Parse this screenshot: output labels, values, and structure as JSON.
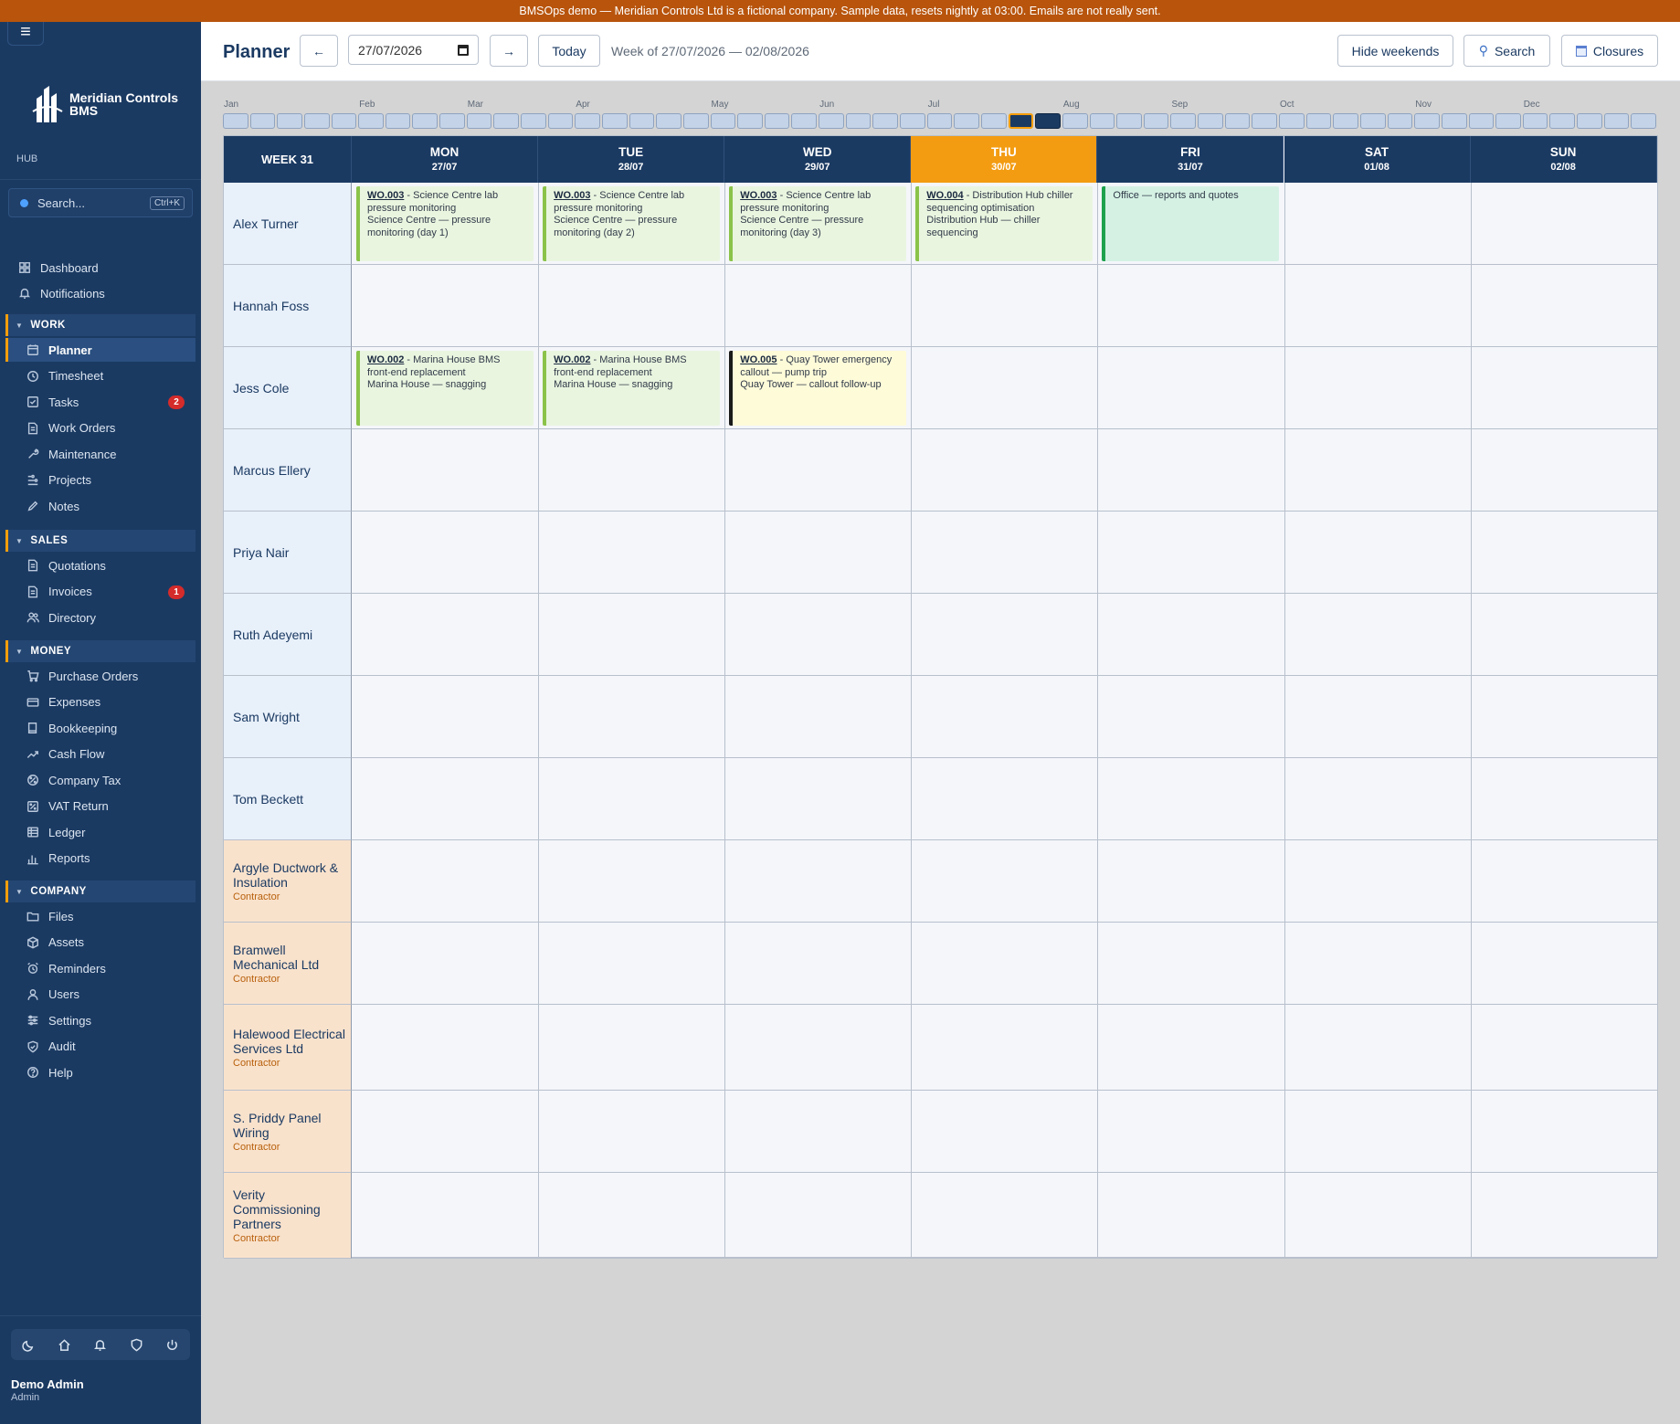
{
  "banner": "BMSOps demo — Meridian Controls Ltd is a fictional company. Sample data, resets nightly at 03:00. Emails are not really sent.",
  "sidebar": {
    "brand_name": "Meridian Controls",
    "brand_sub": "BMS",
    "hub": "HUB",
    "search_placeholder": "Search...",
    "search_shortcut": "Ctrl+K",
    "top_items": [
      {
        "label": "Dashboard",
        "icon": "grid-icon"
      },
      {
        "label": "Notifications",
        "icon": "bell-icon"
      }
    ],
    "sections": [
      {
        "title": "WORK",
        "items": [
          {
            "label": "Planner",
            "active": true
          },
          {
            "label": "Timesheet"
          },
          {
            "label": "Tasks",
            "badge": "2"
          },
          {
            "label": "Work Orders"
          },
          {
            "label": "Maintenance"
          },
          {
            "label": "Projects"
          },
          {
            "label": "Notes"
          }
        ]
      },
      {
        "title": "SALES",
        "items": [
          {
            "label": "Quotations"
          },
          {
            "label": "Invoices",
            "badge": "1"
          },
          {
            "label": "Directory"
          }
        ]
      },
      {
        "title": "MONEY",
        "items": [
          {
            "label": "Purchase Orders"
          },
          {
            "label": "Expenses"
          },
          {
            "label": "Bookkeeping"
          },
          {
            "label": "Cash Flow"
          },
          {
            "label": "Company Tax"
          },
          {
            "label": "VAT Return"
          },
          {
            "label": "Ledger"
          },
          {
            "label": "Reports"
          }
        ]
      },
      {
        "title": "COMPANY",
        "items": [
          {
            "label": "Files"
          },
          {
            "label": "Assets"
          },
          {
            "label": "Reminders"
          },
          {
            "label": "Users"
          },
          {
            "label": "Settings"
          },
          {
            "label": "Audit"
          },
          {
            "label": "Help"
          }
        ]
      }
    ],
    "user": {
      "name": "Demo Admin",
      "role": "Admin"
    }
  },
  "header": {
    "title": "Planner",
    "prev": "←",
    "date_value": "27/07/2026",
    "next": "→",
    "today": "Today",
    "week_range": "Week of 27/07/2026 — 02/08/2026",
    "hide_weekends": "Hide weekends",
    "search": "Search",
    "closures": "Closures"
  },
  "months": [
    "Jan",
    "Feb",
    "Mar",
    "Apr",
    "May",
    "Jun",
    "Jul",
    "Aug",
    "Sep",
    "Oct",
    "Nov",
    "Dec"
  ],
  "week_strip": {
    "total_weeks": 53,
    "current_week_index": 30,
    "selected_week_index": 29
  },
  "grid": {
    "week_label": "WEEK 31",
    "days": [
      {
        "day": "MON",
        "date": "27/07"
      },
      {
        "day": "TUE",
        "date": "28/07"
      },
      {
        "day": "WED",
        "date": "29/07"
      },
      {
        "day": "THU",
        "date": "30/07",
        "today": true
      },
      {
        "day": "FRI",
        "date": "31/07"
      },
      {
        "day": "SAT",
        "date": "01/08"
      },
      {
        "day": "SUN",
        "date": "02/08"
      }
    ],
    "rows": [
      {
        "name": "Alex Turner"
      },
      {
        "name": "Hannah Foss"
      },
      {
        "name": "Jess Cole"
      },
      {
        "name": "Marcus Ellery"
      },
      {
        "name": "Priya Nair"
      },
      {
        "name": "Ruth Adeyemi"
      },
      {
        "name": "Sam Wright"
      },
      {
        "name": "Tom Beckett"
      },
      {
        "name": "Argyle Ductwork & Insulation",
        "tag": "Contractor"
      },
      {
        "name": "Bramwell Mechanical Ltd",
        "tag": "Contractor"
      },
      {
        "name": "Halewood Electrical Services Ltd",
        "tag": "Contractor"
      },
      {
        "name": "S. Priddy Panel Wiring",
        "tag": "Contractor"
      },
      {
        "name": "Verity Commissioning Partners",
        "tag": "Contractor"
      }
    ],
    "tasks": [
      {
        "row": 0,
        "day": 0,
        "style": "green",
        "wo": "WO.003",
        "title": " - Science Centre lab pressure monitoring",
        "detail": "Science Centre — pressure monitoring (day 1)"
      },
      {
        "row": 0,
        "day": 1,
        "style": "green",
        "wo": "WO.003",
        "title": " - Science Centre lab pressure monitoring",
        "detail": "Science Centre — pressure monitoring (day 2)"
      },
      {
        "row": 0,
        "day": 2,
        "style": "green",
        "wo": "WO.003",
        "title": " - Science Centre lab pressure monitoring",
        "detail": "Science Centre — pressure monitoring (day 3)"
      },
      {
        "row": 0,
        "day": 3,
        "style": "green",
        "wo": "WO.004",
        "title": " - Distribution Hub chiller sequencing optimisation",
        "detail": "Distribution Hub — chiller sequencing"
      },
      {
        "row": 0,
        "day": 4,
        "style": "office",
        "wo": "",
        "title": "Office — reports and quotes",
        "detail": ""
      },
      {
        "row": 2,
        "day": 0,
        "style": "green",
        "wo": "WO.002",
        "title": " - Marina House BMS front-end replacement",
        "detail": "Marina House — snagging"
      },
      {
        "row": 2,
        "day": 1,
        "style": "green",
        "wo": "WO.002",
        "title": " - Marina House BMS front-end replacement",
        "detail": "Marina House — snagging"
      },
      {
        "row": 2,
        "day": 2,
        "style": "yellow",
        "wo": "WO.005",
        "title": " - Quay Tower emergency callout — pump trip",
        "detail": "Quay Tower — callout follow-up"
      }
    ]
  }
}
